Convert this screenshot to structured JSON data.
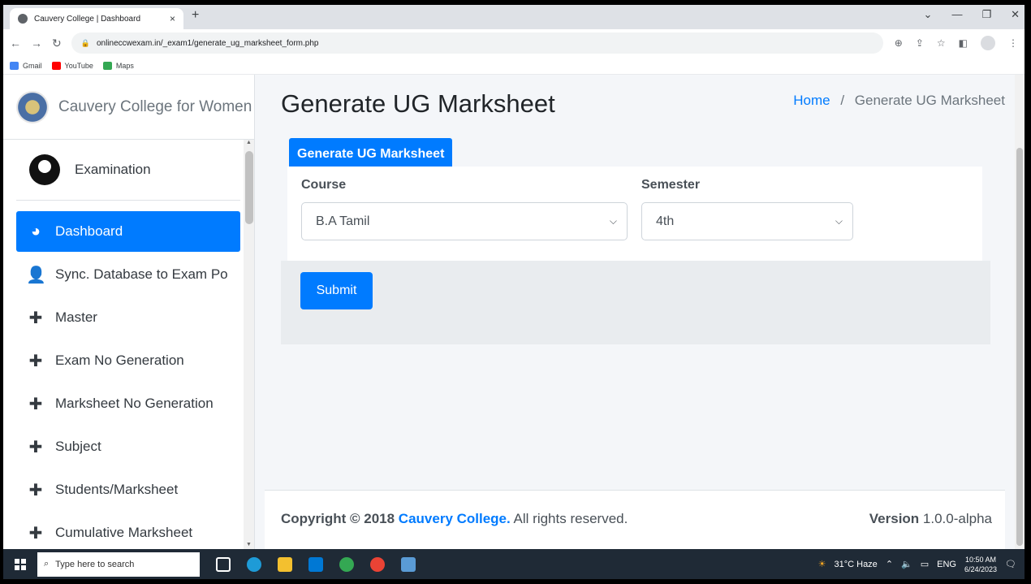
{
  "browser": {
    "tab_title": "Cauvery College | Dashboard",
    "tab_close": "×",
    "new_tab": "+",
    "url": "onlineccwexam.in/_exam1/generate_ug_marksheet_form.php",
    "bookmarks": [
      "Gmail",
      "YouTube",
      "Maps"
    ]
  },
  "sidebar": {
    "brand": "Cauvery College for Women",
    "user": "Examination",
    "items": [
      {
        "label": "Dashboard",
        "icon": "tachometer-icon",
        "active": true
      },
      {
        "label": "Sync. Database to Exam Po",
        "icon": "user-plus-icon"
      },
      {
        "label": "Master",
        "icon": "plus-icon"
      },
      {
        "label": "Exam No Generation",
        "icon": "plus-icon"
      },
      {
        "label": "Marksheet No Generation",
        "icon": "plus-icon"
      },
      {
        "label": "Subject",
        "icon": "plus-icon"
      },
      {
        "label": "Students/Marksheet",
        "icon": "plus-icon"
      },
      {
        "label": "Cumulative Marksheet",
        "icon": "plus-icon"
      }
    ]
  },
  "page": {
    "title": "Generate UG Marksheet",
    "breadcrumb_home": "Home",
    "breadcrumb_sep": "/",
    "breadcrumb_current": "Generate UG Marksheet",
    "card_title": "Generate UG Marksheet"
  },
  "form": {
    "course_label": "Course",
    "course_value": "B.A Tamil",
    "semester_label": "Semester",
    "semester_value": "4th",
    "submit_label": "Submit"
  },
  "footer": {
    "copyright_prefix": "Copyright © 2018",
    "college_link": "Cauvery College.",
    "rights": "All rights reserved.",
    "version_label": "Version",
    "version_value": "1.0.0-alpha"
  },
  "taskbar": {
    "search_placeholder": "Type here to search",
    "weather": "31°C Haze",
    "lang": "ENG",
    "time": "10:50 AM",
    "date": "6/24/2023"
  },
  "colors": {
    "primary": "#007bff",
    "content_bg": "#f4f6f9",
    "footer_panel": "#e9ecef"
  }
}
